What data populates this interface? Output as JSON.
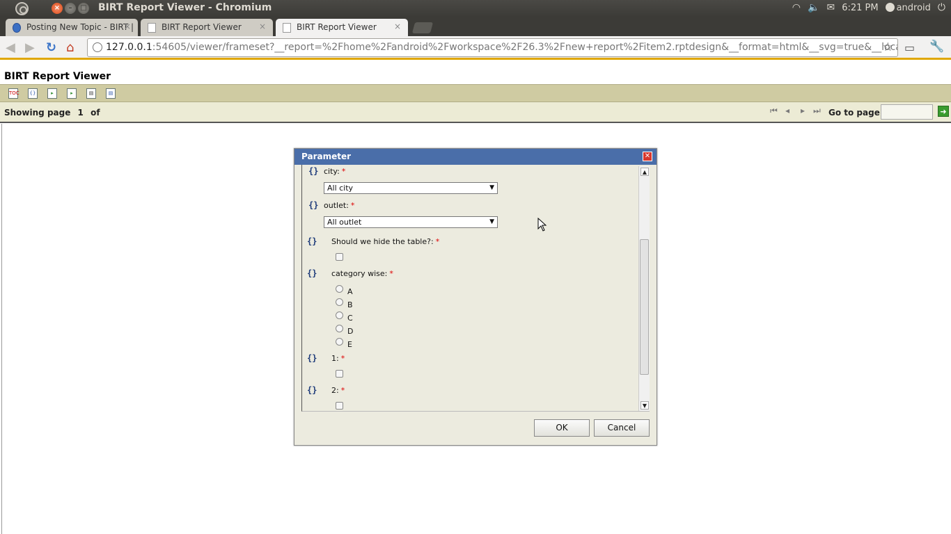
{
  "os": {
    "window_title": "BIRT Report Viewer - Chromium",
    "tray_time": "6:21 PM",
    "tray_user": "android"
  },
  "tabs": [
    {
      "label": "Posting New Topic - BIRT |"
    },
    {
      "label": "BIRT Report Viewer"
    },
    {
      "label": "BIRT Report Viewer"
    }
  ],
  "address_bar": {
    "host": "127.0.0.1",
    "rest": ":54605/viewer/frameset?__report=%2Fhome%2Fandroid%2Fworkspace%2F26.3%2Fnew+report%2Fitem2.rptdesign&__format=html&__svg=true&__locale=e"
  },
  "birt": {
    "title": "BIRT Report Viewer",
    "toolbar_icons": [
      "toc-icon",
      "run-report-icon",
      "export-data-icon",
      "export-report-icon",
      "print-icon",
      "print-server-icon"
    ],
    "showing_label": "Showing page",
    "current_page": "1",
    "of_label": "of",
    "goto_label": "Go to page:"
  },
  "dialog": {
    "title": "Parameter",
    "params": {
      "city": {
        "label": "city:",
        "required": "*",
        "selected": "All city"
      },
      "outlet": {
        "label": "outlet:",
        "required": "*",
        "selected": "All outlet"
      },
      "hide_table": {
        "label": "Should we hide the table?:",
        "required": "*"
      },
      "category": {
        "label": "category wise:",
        "required": "*",
        "options": [
          "A",
          "B",
          "C",
          "D",
          "E"
        ]
      },
      "p1": {
        "label": "1:",
        "required": "*"
      },
      "p2": {
        "label": "2:",
        "required": "*"
      }
    },
    "ok_label": "OK",
    "cancel_label": "Cancel"
  }
}
